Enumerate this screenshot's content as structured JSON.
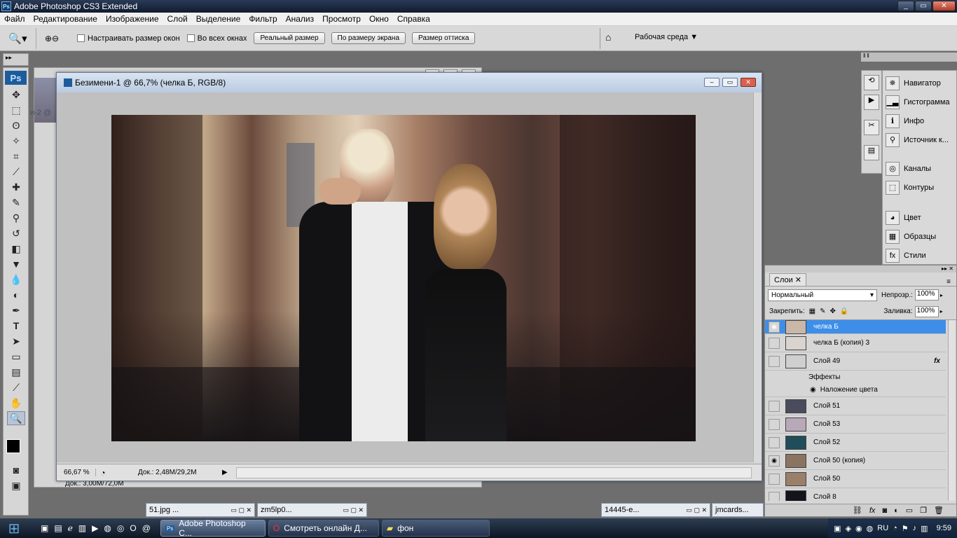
{
  "app": {
    "title": "Adobe Photoshop CS3 Extended"
  },
  "menu": [
    "Файл",
    "Редактирование",
    "Изображение",
    "Слой",
    "Выделение",
    "Фильтр",
    "Анализ",
    "Просмотр",
    "Окно",
    "Справка"
  ],
  "options": {
    "resize_windows": "Настраивать размер окон",
    "all_windows": "Во всех окнах",
    "actual_pixels": "Реальный размер",
    "fit_screen": "По размеру экрана",
    "print_size": "Размер оттиска",
    "workspace": "Рабочая среда"
  },
  "document": {
    "title": "Безимени-1 @ 66,7% (челка Б, RGB/8)",
    "zoom": "66,67 %",
    "doc_size": "Док.: 2,48M/29,2M"
  },
  "background_doc": {
    "tab": "и-2 @",
    "doc_size": "Док.: 3,00M/72,0M"
  },
  "dock": {
    "group1": [
      "Навигатор",
      "Гистограмма",
      "Инфо",
      "Источник к..."
    ],
    "group2": [
      "Каналы",
      "Контуры"
    ],
    "group3": [
      "Цвет",
      "Образцы",
      "Стили"
    ]
  },
  "layers_panel": {
    "tab": "Слои",
    "blend_mode": "Нормальный",
    "opacity_label": "Непрозр.:",
    "opacity": "100%",
    "lock_label": "Закрепить:",
    "fill_label": "Заливка:",
    "fill": "100%",
    "effects_label": "Эффекты",
    "effect_name": "Наложение цвета",
    "layers": [
      {
        "name": "челка Б",
        "visible": true,
        "selected": true,
        "color": "#c9b7a8"
      },
      {
        "name": "челка Б (копия) 3",
        "visible": false,
        "selected": false,
        "color": "#d9d4cf"
      },
      {
        "name": "Слой 49",
        "visible": false,
        "selected": false,
        "color": "#cfcfcf"
      },
      {
        "name": "Слой 51",
        "visible": false,
        "selected": false,
        "color": "#4a4c5e"
      },
      {
        "name": "Слой 53",
        "visible": false,
        "selected": false,
        "color": "#b9a8b8"
      },
      {
        "name": "Слой 52",
        "visible": false,
        "selected": false,
        "color": "#1f4d5a"
      },
      {
        "name": "Слой 50 (копия)",
        "visible": true,
        "selected": false,
        "color": "#8a7361"
      },
      {
        "name": "Слой 50",
        "visible": false,
        "selected": false,
        "color": "#9a7f6a"
      },
      {
        "name": "Слой 8",
        "visible": false,
        "selected": false,
        "color": "#14151c"
      }
    ]
  },
  "minimized": [
    {
      "label": "51.jpg ..."
    },
    {
      "label": "zm5lp0..."
    },
    {
      "label": "14445-e..."
    },
    {
      "label": "jmcards..."
    }
  ],
  "taskbar": {
    "items": [
      "Adobe Photoshop C...",
      "Смотреть онлайн Д...",
      "фон"
    ],
    "lang": "RU",
    "clock": "9:59"
  }
}
